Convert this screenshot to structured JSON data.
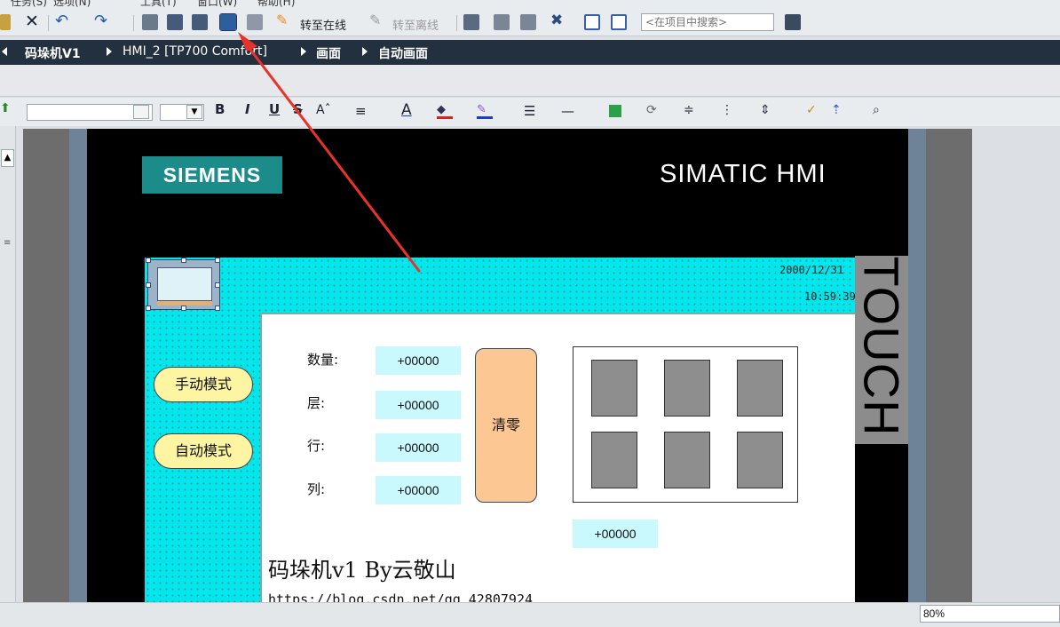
{
  "menubar": {
    "items": [
      "任务(S)",
      "选项(N)",
      "工具(T)",
      "窗口(W)",
      "帮助(H)"
    ]
  },
  "toolbar": {
    "go_online_label": "转至在线",
    "go_offline_label": "转至离线",
    "search_placeholder": "<在项目中搜索>"
  },
  "breadcrumb": {
    "items": [
      "码垛机V1",
      "HMI_2 [TP700 Comfort]",
      "画面",
      "自动画面"
    ]
  },
  "format_toolbar": {
    "bold": "B",
    "italic": "I",
    "underline": "U",
    "strike": "S"
  },
  "hmi_screen": {
    "brand_logo": "SIEMENS",
    "product_title": "SIMATIC HMI",
    "side_text": "TOUCH",
    "date": "2000/12/31",
    "time": "10:59:39",
    "manual_mode_label": "手动模式",
    "auto_mode_label": "自动模式",
    "fields": [
      {
        "label": "数量:",
        "value": "+00000"
      },
      {
        "label": "层:",
        "value": "+00000"
      },
      {
        "label": "行:",
        "value": "+00000"
      },
      {
        "label": "列:",
        "value": "+00000"
      }
    ],
    "clear_button_label": "清零",
    "extra_field_value": "+00000",
    "grid_cells": 6,
    "title_text": "码垛机v1 By云敬山",
    "url_text": "https://blog.csdn.net/qq_42807924"
  },
  "status": {
    "zoom": "80%"
  },
  "colors": {
    "panel_cyan": "#00e8ee",
    "io_field": "#c9f8fd",
    "mode_button": "#fdf5a1",
    "clear_button": "#fcc793",
    "breadcrumb_bg": "#23303f",
    "arrow": "#e8322a"
  }
}
